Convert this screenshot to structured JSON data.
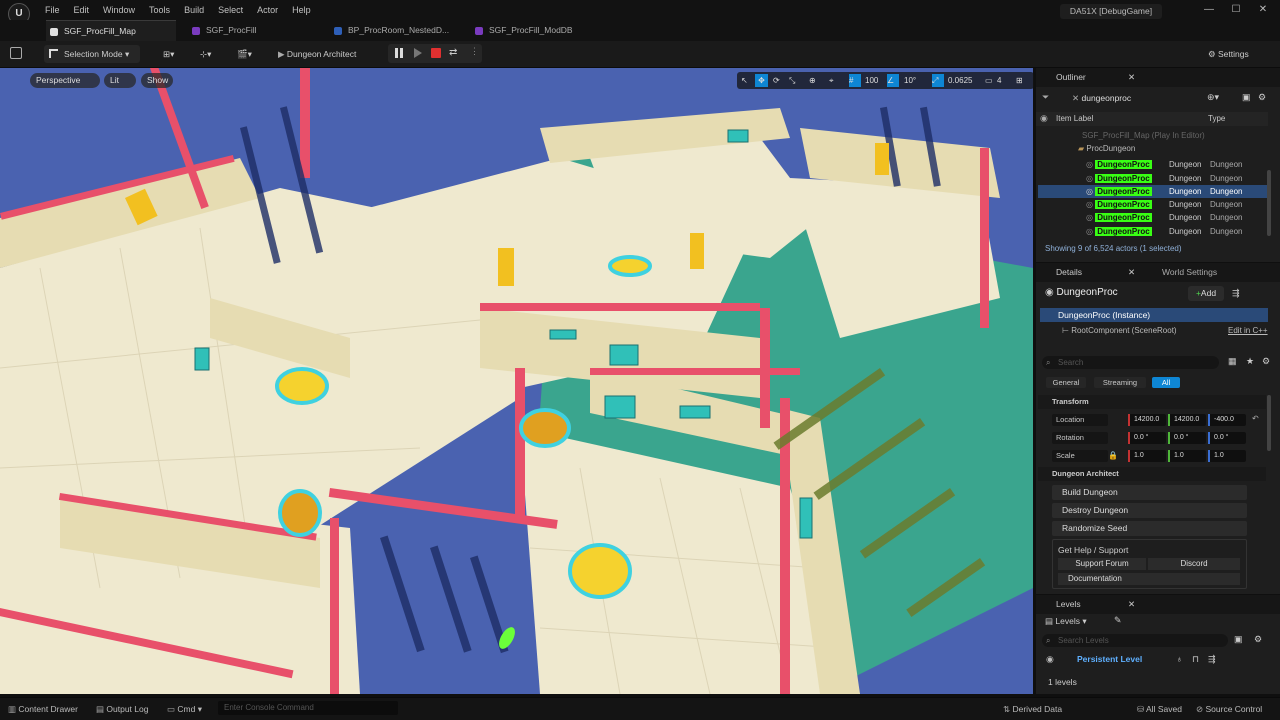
{
  "app": {
    "project_title": "DA51X [DebugGame]",
    "menus": [
      "File",
      "Edit",
      "Window",
      "Tools",
      "Build",
      "Select",
      "Actor",
      "Help"
    ]
  },
  "tabs": [
    {
      "label": "SGF_ProcFill_Map",
      "active": true
    },
    {
      "label": "SGF_ProcFill",
      "active": false
    },
    {
      "label": "BP_ProcRoom_NestedD...",
      "active": false
    },
    {
      "label": "SGF_ProcFill_ModDB",
      "active": false
    }
  ],
  "toolbar": {
    "selection_mode": "Selection Mode",
    "dungeon_architect": "Dungeon Architect",
    "settings": "Settings"
  },
  "viewport": {
    "perspective": "Perspective",
    "lit": "Lit",
    "show": "Show",
    "grid_snap": "100",
    "rot_snap": "10°",
    "scale_snap": "0.0625",
    "camera_speed": "4"
  },
  "outliner": {
    "title": "Outliner",
    "search_value": "dungeonproc",
    "col_label": "Item Label",
    "col_type": "Type",
    "world_row": "SGF_ProcFill_Map (Play In Editor)",
    "folder": "ProcDungeon",
    "items": [
      {
        "label": "DungeonProc",
        "suffix": "Dungeon",
        "type": "Dungeon"
      },
      {
        "label": "DungeonProc",
        "suffix": "Dungeon",
        "type": "Dungeon"
      },
      {
        "label": "DungeonProc",
        "suffix": "Dungeon",
        "type": "Dungeon"
      },
      {
        "label": "DungeonProc",
        "suffix": "Dungeon",
        "type": "Dungeon"
      },
      {
        "label": "DungeonProc",
        "suffix": "Dungeon",
        "type": "Dungeon"
      },
      {
        "label": "DungeonProc",
        "suffix": "Dungeon",
        "type": "Dungeon"
      }
    ],
    "footer": "Showing 9 of 6,524 actors (1 selected)"
  },
  "details": {
    "tab_details": "Details",
    "tab_world": "World Settings",
    "actor_name": "DungeonProc",
    "add": "Add",
    "instance": "DungeonProc (Instance)",
    "root": "RootComponent (SceneRoot)",
    "edit_cpp": "Edit in C++",
    "search_placeholder": "Search",
    "filters": [
      "General",
      "Streaming",
      "All"
    ],
    "transform": "Transform",
    "location": "Location",
    "rotation": "Rotation",
    "scale": "Scale",
    "loc": [
      "14200.0",
      "14200.0",
      "-400.0"
    ],
    "rot": [
      "0.0 °",
      "0.0 °",
      "0.0 °"
    ],
    "scl": [
      "1.0",
      "1.0",
      "1.0"
    ],
    "section_da": "Dungeon Architect",
    "build": "Build Dungeon",
    "destroy": "Destroy Dungeon",
    "randomize": "Randomize Seed",
    "help_title": "Get Help / Support",
    "support": "Support Forum",
    "discord": "Discord",
    "docs": "Documentation"
  },
  "levels": {
    "title": "Levels",
    "dropdown": "Levels",
    "search_placeholder": "Search Levels",
    "persistent": "Persistent Level",
    "count": "1 levels"
  },
  "status": {
    "content_drawer": "Content Drawer",
    "output_log": "Output Log",
    "cmd": "Cmd",
    "console_placeholder": "Enter Console Command",
    "derived": "Derived Data",
    "saved": "All Saved",
    "source": "Source Control"
  },
  "colors": {
    "accent": "#0e86d4",
    "highlight": "#39ff14",
    "wall": "#ece4c4",
    "trim": "#e8506a",
    "floor": "#4a62b0"
  }
}
